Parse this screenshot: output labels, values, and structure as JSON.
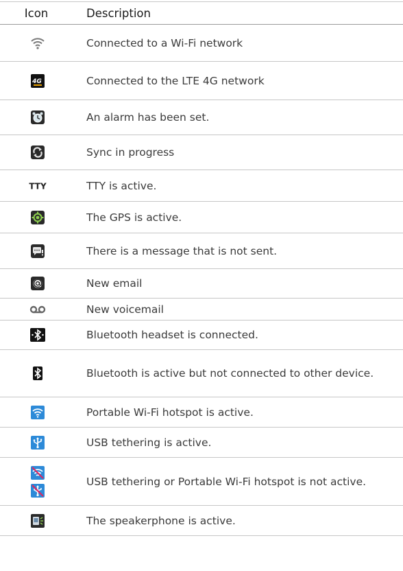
{
  "header": {
    "icon_col": "Icon",
    "desc_col": "Description"
  },
  "rows": [
    {
      "icon": "wifi-connected-icon",
      "description": "Connected to a Wi-Fi network"
    },
    {
      "icon": "lte-4g-icon",
      "description": "Connected to the LTE 4G network",
      "icon_text": "4G"
    },
    {
      "icon": "alarm-icon",
      "description": "An alarm has been set."
    },
    {
      "icon": "sync-icon",
      "description": "Sync in progress"
    },
    {
      "icon": "tty-icon",
      "description": "TTY is active.",
      "icon_text": "TTY"
    },
    {
      "icon": "gps-icon",
      "description": "The GPS is active."
    },
    {
      "icon": "message-not-sent-icon",
      "description": "There is a message that is not sent."
    },
    {
      "icon": "email-icon",
      "description": "New email"
    },
    {
      "icon": "voicemail-icon",
      "description": "New voicemail"
    },
    {
      "icon": "bluetooth-connected-icon",
      "description": "Bluetooth headset is connected."
    },
    {
      "icon": "bluetooth-active-icon",
      "description": "Bluetooth is active but not connected to other device."
    },
    {
      "icon": "portable-hotspot-icon",
      "description": "Portable Wi-Fi hotspot is active."
    },
    {
      "icon": "usb-tethering-icon",
      "description": "USB tethering is active."
    },
    {
      "icon": "tethering-hotspot-off-icons",
      "description": "USB tethering or Portable Wi-Fi hotspot is not active."
    },
    {
      "icon": "speakerphone-icon",
      "description": "The speakerphone is active."
    }
  ]
}
